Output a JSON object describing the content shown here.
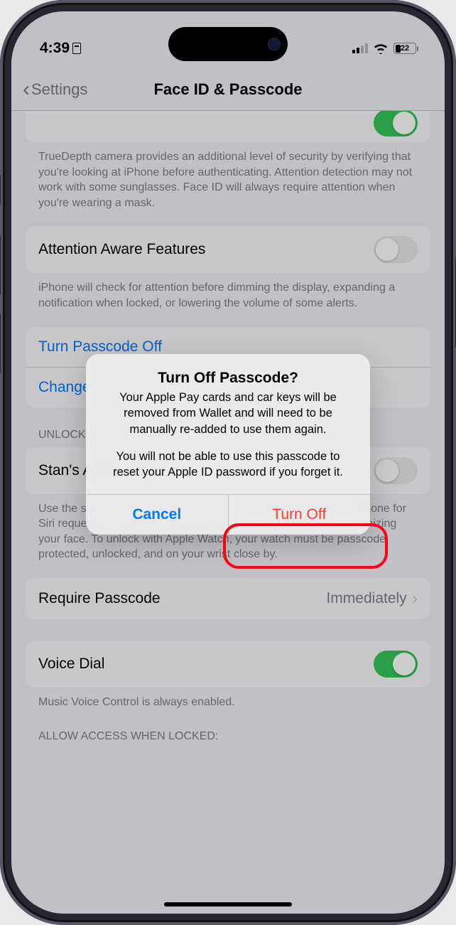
{
  "status": {
    "time": "4:39",
    "battery_pct": "22"
  },
  "nav": {
    "back": "Settings",
    "title": "Face ID & Passcode"
  },
  "sections": {
    "truedepth_footer": "TrueDepth camera provides an additional level of security by verifying that you're looking at iPhone before authenticating. Attention detection may not work with some sunglasses. Face ID will always require attention when you're wearing a mask.",
    "attention_label": "Attention Aware Features",
    "attention_footer": "iPhone will check for attention before dimming the display, expanding a notification when locked, or lowering the volume of some alerts.",
    "turn_off_link": "Turn Passcode Off",
    "change_link": "Change Passcode",
    "unlock_header": "UNLOCK WITH APPLE WATCH",
    "watch_label": "Stan's Apple Watch",
    "watch_footer": "Use the secure connection to your Apple Watch to unlock your iPhone for Siri requests or when an obstruction prevents Face ID from recognizing your face. To unlock with Apple Watch, your watch must be passcode protected, unlocked, and on your wrist close by.",
    "require_label": "Require Passcode",
    "require_value": "Immediately",
    "voice_label": "Voice Dial",
    "voice_footer": "Music Voice Control is always enabled.",
    "access_header": "ALLOW ACCESS WHEN LOCKED:"
  },
  "alert": {
    "title": "Turn Off Passcode?",
    "message1": "Your Apple Pay cards and car keys will be removed from Wallet and will need to be manually re-added to use them again.",
    "message2": "You will not be able to use this passcode to reset your Apple ID password if you forget it.",
    "cancel": "Cancel",
    "confirm": "Turn Off"
  }
}
